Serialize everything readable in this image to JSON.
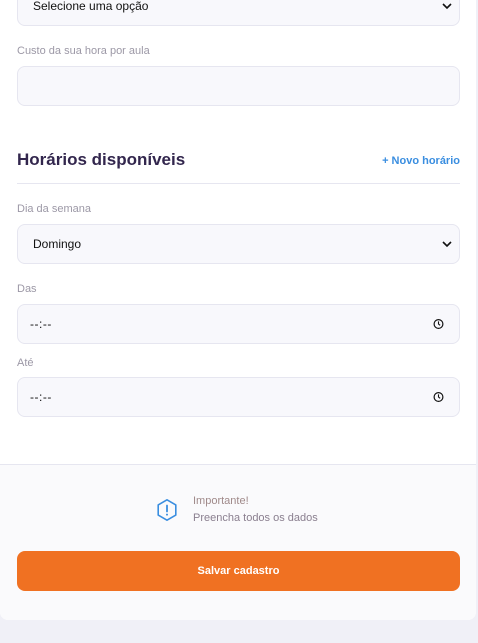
{
  "form": {
    "subject_select": {
      "value": "Selecione uma opção"
    },
    "cost": {
      "label": "Custo da sua hora por aula",
      "value": ""
    }
  },
  "schedule": {
    "title": "Horários disponíveis",
    "new_slot_label": "+ Novo horário",
    "weekday": {
      "label": "Dia da semana",
      "value": "Domingo"
    },
    "from": {
      "label": "Das",
      "value": "--:--"
    },
    "to": {
      "label": "Até",
      "value": "--:--"
    }
  },
  "footer": {
    "warning_title": "Importante!",
    "warning_text": "Preencha todos os dados",
    "save_label": "Salvar cadastro"
  },
  "colors": {
    "accent_orange": "#f07122",
    "link_blue": "#3a8ee0",
    "title": "#32264d",
    "warning_icon": "#3a8ee0"
  },
  "icons": [
    "chevron-down-icon",
    "clock-icon",
    "warning-icon"
  ]
}
